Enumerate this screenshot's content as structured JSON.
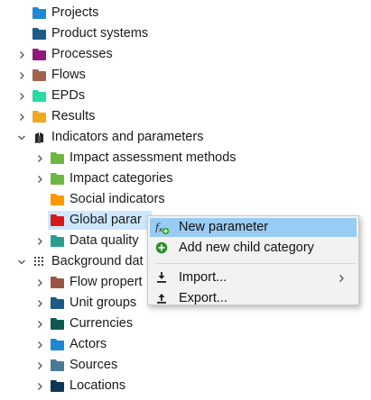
{
  "tree": {
    "items": [
      {
        "label": "Projects",
        "color": "#1e88d3",
        "depth": 1,
        "chevron": "none"
      },
      {
        "label": "Product systems",
        "color": "#1d5a85",
        "depth": 1,
        "chevron": "none"
      },
      {
        "label": "Processes",
        "color": "#8e1a80",
        "depth": 1,
        "chevron": "right"
      },
      {
        "label": "Flows",
        "color": "#a0644a",
        "depth": 1,
        "chevron": "right"
      },
      {
        "label": "EPDs",
        "color": "#2bd9a2",
        "depth": 1,
        "chevron": "right"
      },
      {
        "label": "Results",
        "color": "#f0a81c",
        "depth": 1,
        "chevron": "right"
      },
      {
        "label": "Indicators and parameters",
        "icon": "indicators-icon",
        "depth": 1,
        "chevron": "down"
      },
      {
        "label": "Impact assessment methods",
        "color": "#6cb844",
        "depth": 2,
        "chevron": "right"
      },
      {
        "label": "Impact categories",
        "color": "#6cb844",
        "depth": 2,
        "chevron": "right"
      },
      {
        "label": "Social indicators",
        "color": "#ff9800",
        "depth": 2,
        "chevron": "none"
      },
      {
        "label": "Global parar",
        "color": "#d61a1a",
        "depth": 2,
        "chevron": "none",
        "selected": true
      },
      {
        "label": "Data quality",
        "color": "#2a9d8f",
        "depth": 2,
        "chevron": "right"
      },
      {
        "label": "Background dat",
        "icon": "background-data-icon",
        "depth": 1,
        "chevron": "down"
      },
      {
        "label": "Flow propert",
        "color": "#9b5545",
        "depth": 2,
        "chevron": "right"
      },
      {
        "label": "Unit groups",
        "color": "#1d5a85",
        "depth": 2,
        "chevron": "right"
      },
      {
        "label": "Currencies",
        "color": "#0e5a52",
        "depth": 2,
        "chevron": "right"
      },
      {
        "label": "Actors",
        "color": "#1e88d3",
        "depth": 2,
        "chevron": "right"
      },
      {
        "label": "Sources",
        "color": "#4a7a96",
        "depth": 2,
        "chevron": "right"
      },
      {
        "label": "Locations",
        "color": "#0d3655",
        "depth": 2,
        "chevron": "right"
      }
    ]
  },
  "context_menu": {
    "items": [
      {
        "label": "New parameter",
        "icon": "new-parameter-icon",
        "highlighted": true
      },
      {
        "label": "Add new child category",
        "icon": "add-child-category-icon"
      },
      {
        "separator": true
      },
      {
        "label": "Import...",
        "icon": "import-icon",
        "submenu": true
      },
      {
        "label": "Export...",
        "icon": "export-icon"
      }
    ]
  }
}
